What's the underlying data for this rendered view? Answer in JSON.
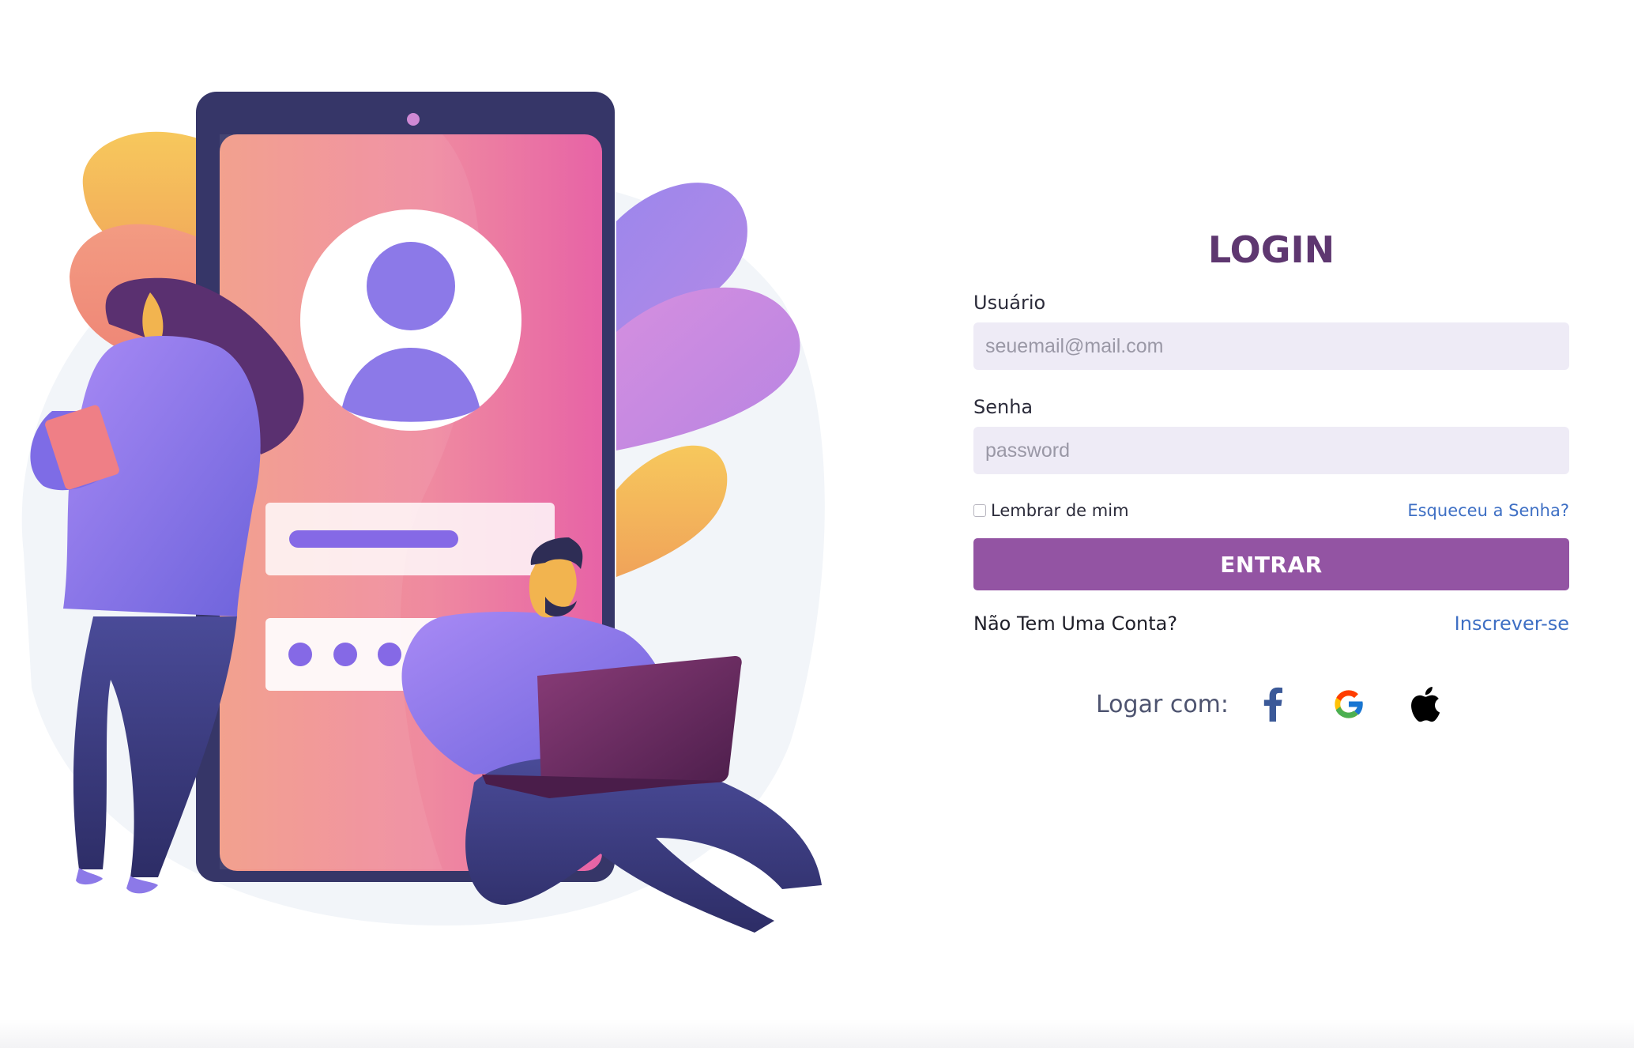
{
  "login": {
    "title": "LOGIN",
    "username_label": "Usuário",
    "username_placeholder": "seuemail@mail.com",
    "password_label": "Senha",
    "password_placeholder": "password",
    "remember_label": "Lembrar de mim",
    "forgot_link": "Esqueceu a Senha?",
    "submit_label": "ENTRAR",
    "no_account_text": "Não Tem Uma Conta?",
    "signup_link": "Inscrever-se",
    "social_label": "Logar com:"
  },
  "social_icons": [
    "facebook-icon",
    "google-icon",
    "apple-icon"
  ],
  "colors": {
    "title": "#5e3770",
    "button": "#9354a3",
    "link": "#3e6fc4",
    "input_bg": "#eeebf6",
    "facebook": "#3b5998"
  }
}
